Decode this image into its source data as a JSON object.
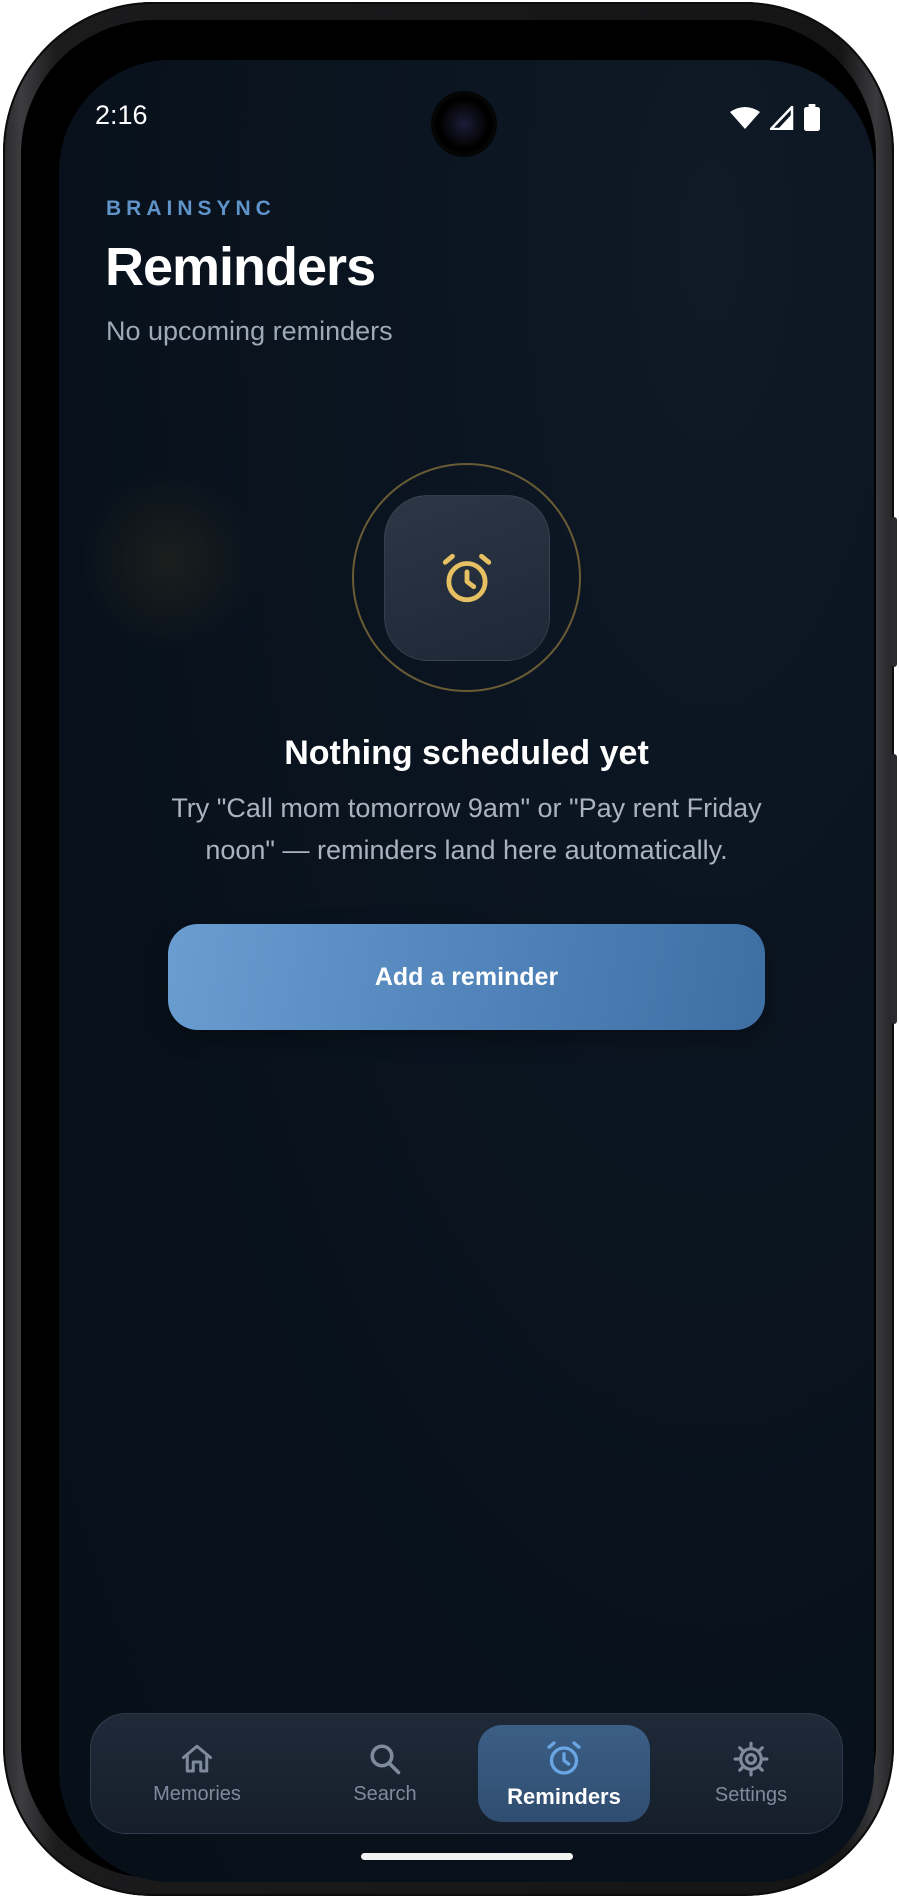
{
  "status_bar": {
    "time": "2:16",
    "icons": [
      "wifi-icon",
      "signal-icon",
      "battery-icon"
    ]
  },
  "header": {
    "brand": "BRAINSYNC",
    "title": "Reminders",
    "subtitle": "No upcoming reminders"
  },
  "empty_state": {
    "icon": "alarm-clock-icon",
    "title": "Nothing scheduled yet",
    "body": "Try \"Call mom tomorrow 9am\" or \"Pay rent Friday noon\" — reminders land here automatically.",
    "cta_label": "Add a reminder"
  },
  "nav": {
    "items": [
      {
        "label": "Memories",
        "icon": "home-icon",
        "active": false
      },
      {
        "label": "Search",
        "icon": "search-icon",
        "active": false
      },
      {
        "label": "Reminders",
        "icon": "alarm-clock-icon",
        "active": true
      },
      {
        "label": "Settings",
        "icon": "gear-icon",
        "active": false
      }
    ]
  },
  "colors": {
    "accent": "#5f93c9",
    "gold": "#e6c063",
    "background": "#08111b",
    "cta_start": "#6a9dd0",
    "cta_end": "#3e6fa3"
  }
}
